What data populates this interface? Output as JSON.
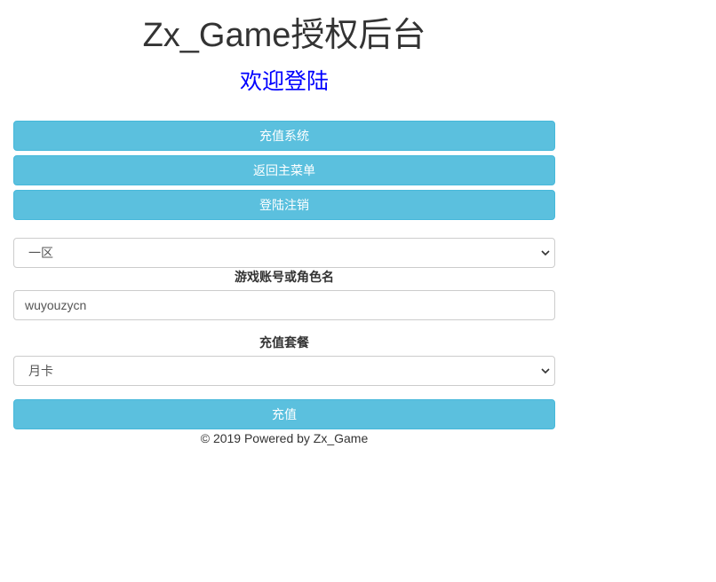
{
  "header": {
    "title": "Zx_Game授权后台",
    "subtitle": "欢迎登陆"
  },
  "nav": {
    "recharge_system_label": "充值系统",
    "back_main_menu_label": "返回主菜单",
    "logout_label": "登陆注销"
  },
  "form": {
    "server_select_value": "一区",
    "account_label": "游戏账号或角色名",
    "account_value": "wuyouzycn",
    "package_label": "充值套餐",
    "package_select_value": "月卡",
    "submit_label": "充值"
  },
  "footer": {
    "text": "© 2019 Powered by Zx_Game"
  },
  "colors": {
    "button_bg": "#5bc0de",
    "subtitle": "#0000ff"
  }
}
